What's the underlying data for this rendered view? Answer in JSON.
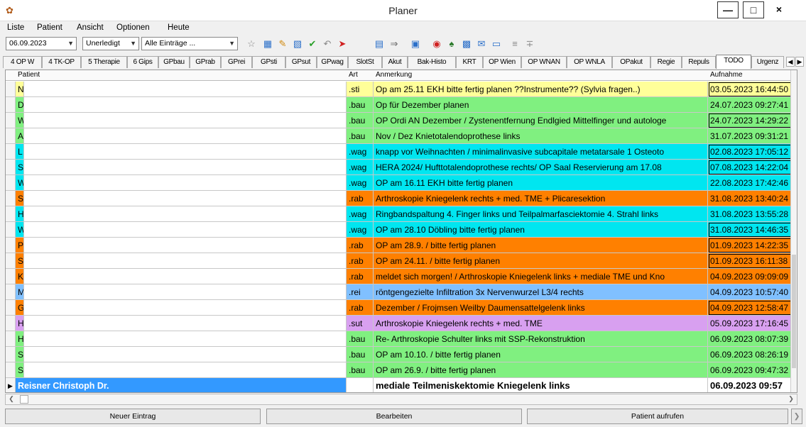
{
  "window": {
    "title": "Planer"
  },
  "menu": [
    "Liste",
    "Patient",
    "Ansicht",
    "Optionen",
    "Heute"
  ],
  "toolbar": {
    "date": "06.09.2023",
    "status": "Unerledigt",
    "filter": "Alle Einträge ..."
  },
  "tabs": [
    "4 OP W",
    "4 TK-OP",
    "5 Therapie",
    "6 Gips",
    "GPbau",
    "GPrab",
    "GPrei",
    "GPsti",
    "GPsut",
    "GPwag",
    "SlotSt",
    "Akut",
    "Bak-Histo",
    "KRT",
    "OP Wien",
    "OP WNAN",
    "OP WNLA",
    "OPakut",
    "Regie",
    "Repuls",
    "TODO",
    "Urgenz"
  ],
  "active_tab": "TODO",
  "columns": {
    "patient": "Patient",
    "art": "Art",
    "anmerkung": "Anmerkung",
    "aufnahme": "Aufnahme"
  },
  "colors": {
    "sti": "#ffff99",
    "bau": "#80f080",
    "wag": "#00e6f0",
    "rab": "#ff8000",
    "rei": "#80c0ff",
    "sut": "#d8a0f0",
    "selected": "#3399ff"
  },
  "rows": [
    {
      "patient": "N",
      "art": ".sti",
      "anmerkung": "Op am 25.11 EKH bitte fertig planen  ??Instrumente?? (Sylvia fragen..)",
      "aufnahme": "03.05.2023 16:44:50",
      "color": "#ffff99",
      "boxed": true
    },
    {
      "patient": "D",
      "art": ".bau",
      "anmerkung": "Op für Dezember planen",
      "aufnahme": "24.07.2023 09:27:41",
      "color": "#80f080",
      "boxed": false
    },
    {
      "patient": "W",
      "art": ".bau",
      "anmerkung": "OP Ordi AN Dezember / Zystenentfernung Endlgied Mittelfinger und autologe",
      "aufnahme": "24.07.2023 14:29:22",
      "color": "#80f080",
      "boxed": true
    },
    {
      "patient": "A",
      "art": ".bau",
      "anmerkung": "Nov / Dez  Knietotalendoprothese links",
      "aufnahme": "31.07.2023 09:31:21",
      "color": "#80f080",
      "boxed": false
    },
    {
      "patient": "L",
      "art": ".wag",
      "anmerkung": "knapp vor Weihnachten / minimalinvasive subcapitale metatarsale 1 Osteoto",
      "aufnahme": "02.08.2023 17:05:12",
      "color": "#00e6f0",
      "boxed": true
    },
    {
      "patient": "S",
      "art": ".wag",
      "anmerkung": "HERA  2024/  Hufttotalendoprothese rechts/ OP Saal Reservierung am 17.08",
      "aufnahme": "07.08.2023 14:22:04",
      "color": "#00e6f0",
      "boxed": true
    },
    {
      "patient": "W",
      "art": ".wag",
      "anmerkung": "OP am 16.11 EKH bitte fertig planen",
      "aufnahme": "22.08.2023 17:42:46",
      "color": "#00e6f0",
      "boxed": false
    },
    {
      "patient": "S",
      "art": ".rab",
      "anmerkung": "Arthroskopie Kniegelenk rechts + med. TME + Plicaresektion",
      "aufnahme": "31.08.2023 13:40:24",
      "color": "#ff8000",
      "boxed": false
    },
    {
      "patient": "H",
      "art": ".wag",
      "anmerkung": "Ringbandspaltung 4. Finger links und Teilpalmarfasciektomie 4. Strahl links",
      "aufnahme": "31.08.2023 13:55:28",
      "color": "#00e6f0",
      "boxed": false
    },
    {
      "patient": "W",
      "art": ".wag",
      "anmerkung": "OP am 28.10 Döbling bitte fertig planen",
      "aufnahme": "31.08.2023 14:46:35",
      "color": "#00e6f0",
      "boxed": true
    },
    {
      "patient": "P",
      "art": ".rab",
      "anmerkung": "OP am 28.9. / bitte fertig planen",
      "aufnahme": "01.09.2023 14:22:35",
      "color": "#ff8000",
      "boxed": true
    },
    {
      "patient": "S",
      "art": ".rab",
      "anmerkung": "OP am 24.11. / bitte fertig planen",
      "aufnahme": "01.09.2023 16:11:38",
      "color": "#ff8000",
      "boxed": true
    },
    {
      "patient": "K",
      "art": ".rab",
      "anmerkung": "meldet sich morgen! / Arthroskopie Kniegelenk links + mediale TME und Kno",
      "aufnahme": "04.09.2023 09:09:09",
      "color": "#ff8000",
      "boxed": false
    },
    {
      "patient": "M",
      "art": ".rei",
      "anmerkung": "röntgengezielte Infiltration 3x Nervenwurzel L3/4 rechts",
      "aufnahme": "04.09.2023 10:57:40",
      "color": "#80c0ff",
      "boxed": false
    },
    {
      "patient": "G",
      "art": ".rab",
      "anmerkung": "Dezember / Frojmsen Weilby Daumensattelgelenk links",
      "aufnahme": "04.09.2023 12:58:47",
      "color": "#ff8000",
      "boxed": true
    },
    {
      "patient": "H",
      "art": ".sut",
      "anmerkung": "Arthroskopie Kniegelenk rechts + med. TME",
      "aufnahme": "05.09.2023 17:16:45",
      "color": "#d8a0f0",
      "boxed": false
    },
    {
      "patient": "H",
      "art": ".bau",
      "anmerkung": "Re- Arthroskopie Schulter links mit SSP-Rekonstruktion",
      "aufnahme": "06.09.2023 08:07:39",
      "color": "#80f080",
      "boxed": false
    },
    {
      "patient": "S",
      "art": ".bau",
      "anmerkung": "OP am 10.10. / bitte fertig planen",
      "aufnahme": "06.09.2023 08:26:19",
      "color": "#80f080",
      "boxed": false
    },
    {
      "patient": "S",
      "art": ".bau",
      "anmerkung": "OP am 26.9. / bitte fertig planen",
      "aufnahme": "06.09.2023 09:47:32",
      "color": "#80f080",
      "boxed": false
    }
  ],
  "selected_row": {
    "patient": "Reisner Christoph Dr.",
    "art": "",
    "anmerkung": "mediale Teilmeniskektomie Kniegelenk links",
    "aufnahme": "06.09.2023 09:57"
  },
  "buttons": {
    "new": "Neuer Eintrag",
    "edit": "Bearbeiten",
    "open": "Patient aufrufen"
  }
}
